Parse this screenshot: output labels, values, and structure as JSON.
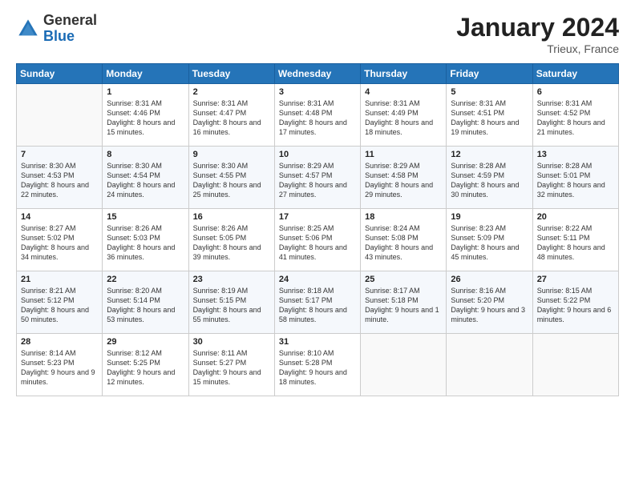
{
  "header": {
    "logo_general": "General",
    "logo_blue": "Blue",
    "title": "January 2024",
    "location": "Trieux, France"
  },
  "weekdays": [
    "Sunday",
    "Monday",
    "Tuesday",
    "Wednesday",
    "Thursday",
    "Friday",
    "Saturday"
  ],
  "weeks": [
    [
      {
        "day": "",
        "sunrise": "",
        "sunset": "",
        "daylight": ""
      },
      {
        "day": "1",
        "sunrise": "Sunrise: 8:31 AM",
        "sunset": "Sunset: 4:46 PM",
        "daylight": "Daylight: 8 hours and 15 minutes."
      },
      {
        "day": "2",
        "sunrise": "Sunrise: 8:31 AM",
        "sunset": "Sunset: 4:47 PM",
        "daylight": "Daylight: 8 hours and 16 minutes."
      },
      {
        "day": "3",
        "sunrise": "Sunrise: 8:31 AM",
        "sunset": "Sunset: 4:48 PM",
        "daylight": "Daylight: 8 hours and 17 minutes."
      },
      {
        "day": "4",
        "sunrise": "Sunrise: 8:31 AM",
        "sunset": "Sunset: 4:49 PM",
        "daylight": "Daylight: 8 hours and 18 minutes."
      },
      {
        "day": "5",
        "sunrise": "Sunrise: 8:31 AM",
        "sunset": "Sunset: 4:51 PM",
        "daylight": "Daylight: 8 hours and 19 minutes."
      },
      {
        "day": "6",
        "sunrise": "Sunrise: 8:31 AM",
        "sunset": "Sunset: 4:52 PM",
        "daylight": "Daylight: 8 hours and 21 minutes."
      }
    ],
    [
      {
        "day": "7",
        "sunrise": "Sunrise: 8:30 AM",
        "sunset": "Sunset: 4:53 PM",
        "daylight": "Daylight: 8 hours and 22 minutes."
      },
      {
        "day": "8",
        "sunrise": "Sunrise: 8:30 AM",
        "sunset": "Sunset: 4:54 PM",
        "daylight": "Daylight: 8 hours and 24 minutes."
      },
      {
        "day": "9",
        "sunrise": "Sunrise: 8:30 AM",
        "sunset": "Sunset: 4:55 PM",
        "daylight": "Daylight: 8 hours and 25 minutes."
      },
      {
        "day": "10",
        "sunrise": "Sunrise: 8:29 AM",
        "sunset": "Sunset: 4:57 PM",
        "daylight": "Daylight: 8 hours and 27 minutes."
      },
      {
        "day": "11",
        "sunrise": "Sunrise: 8:29 AM",
        "sunset": "Sunset: 4:58 PM",
        "daylight": "Daylight: 8 hours and 29 minutes."
      },
      {
        "day": "12",
        "sunrise": "Sunrise: 8:28 AM",
        "sunset": "Sunset: 4:59 PM",
        "daylight": "Daylight: 8 hours and 30 minutes."
      },
      {
        "day": "13",
        "sunrise": "Sunrise: 8:28 AM",
        "sunset": "Sunset: 5:01 PM",
        "daylight": "Daylight: 8 hours and 32 minutes."
      }
    ],
    [
      {
        "day": "14",
        "sunrise": "Sunrise: 8:27 AM",
        "sunset": "Sunset: 5:02 PM",
        "daylight": "Daylight: 8 hours and 34 minutes."
      },
      {
        "day": "15",
        "sunrise": "Sunrise: 8:26 AM",
        "sunset": "Sunset: 5:03 PM",
        "daylight": "Daylight: 8 hours and 36 minutes."
      },
      {
        "day": "16",
        "sunrise": "Sunrise: 8:26 AM",
        "sunset": "Sunset: 5:05 PM",
        "daylight": "Daylight: 8 hours and 39 minutes."
      },
      {
        "day": "17",
        "sunrise": "Sunrise: 8:25 AM",
        "sunset": "Sunset: 5:06 PM",
        "daylight": "Daylight: 8 hours and 41 minutes."
      },
      {
        "day": "18",
        "sunrise": "Sunrise: 8:24 AM",
        "sunset": "Sunset: 5:08 PM",
        "daylight": "Daylight: 8 hours and 43 minutes."
      },
      {
        "day": "19",
        "sunrise": "Sunrise: 8:23 AM",
        "sunset": "Sunset: 5:09 PM",
        "daylight": "Daylight: 8 hours and 45 minutes."
      },
      {
        "day": "20",
        "sunrise": "Sunrise: 8:22 AM",
        "sunset": "Sunset: 5:11 PM",
        "daylight": "Daylight: 8 hours and 48 minutes."
      }
    ],
    [
      {
        "day": "21",
        "sunrise": "Sunrise: 8:21 AM",
        "sunset": "Sunset: 5:12 PM",
        "daylight": "Daylight: 8 hours and 50 minutes."
      },
      {
        "day": "22",
        "sunrise": "Sunrise: 8:20 AM",
        "sunset": "Sunset: 5:14 PM",
        "daylight": "Daylight: 8 hours and 53 minutes."
      },
      {
        "day": "23",
        "sunrise": "Sunrise: 8:19 AM",
        "sunset": "Sunset: 5:15 PM",
        "daylight": "Daylight: 8 hours and 55 minutes."
      },
      {
        "day": "24",
        "sunrise": "Sunrise: 8:18 AM",
        "sunset": "Sunset: 5:17 PM",
        "daylight": "Daylight: 8 hours and 58 minutes."
      },
      {
        "day": "25",
        "sunrise": "Sunrise: 8:17 AM",
        "sunset": "Sunset: 5:18 PM",
        "daylight": "Daylight: 9 hours and 1 minute."
      },
      {
        "day": "26",
        "sunrise": "Sunrise: 8:16 AM",
        "sunset": "Sunset: 5:20 PM",
        "daylight": "Daylight: 9 hours and 3 minutes."
      },
      {
        "day": "27",
        "sunrise": "Sunrise: 8:15 AM",
        "sunset": "Sunset: 5:22 PM",
        "daylight": "Daylight: 9 hours and 6 minutes."
      }
    ],
    [
      {
        "day": "28",
        "sunrise": "Sunrise: 8:14 AM",
        "sunset": "Sunset: 5:23 PM",
        "daylight": "Daylight: 9 hours and 9 minutes."
      },
      {
        "day": "29",
        "sunrise": "Sunrise: 8:12 AM",
        "sunset": "Sunset: 5:25 PM",
        "daylight": "Daylight: 9 hours and 12 minutes."
      },
      {
        "day": "30",
        "sunrise": "Sunrise: 8:11 AM",
        "sunset": "Sunset: 5:27 PM",
        "daylight": "Daylight: 9 hours and 15 minutes."
      },
      {
        "day": "31",
        "sunrise": "Sunrise: 8:10 AM",
        "sunset": "Sunset: 5:28 PM",
        "daylight": "Daylight: 9 hours and 18 minutes."
      },
      {
        "day": "",
        "sunrise": "",
        "sunset": "",
        "daylight": ""
      },
      {
        "day": "",
        "sunrise": "",
        "sunset": "",
        "daylight": ""
      },
      {
        "day": "",
        "sunrise": "",
        "sunset": "",
        "daylight": ""
      }
    ]
  ]
}
